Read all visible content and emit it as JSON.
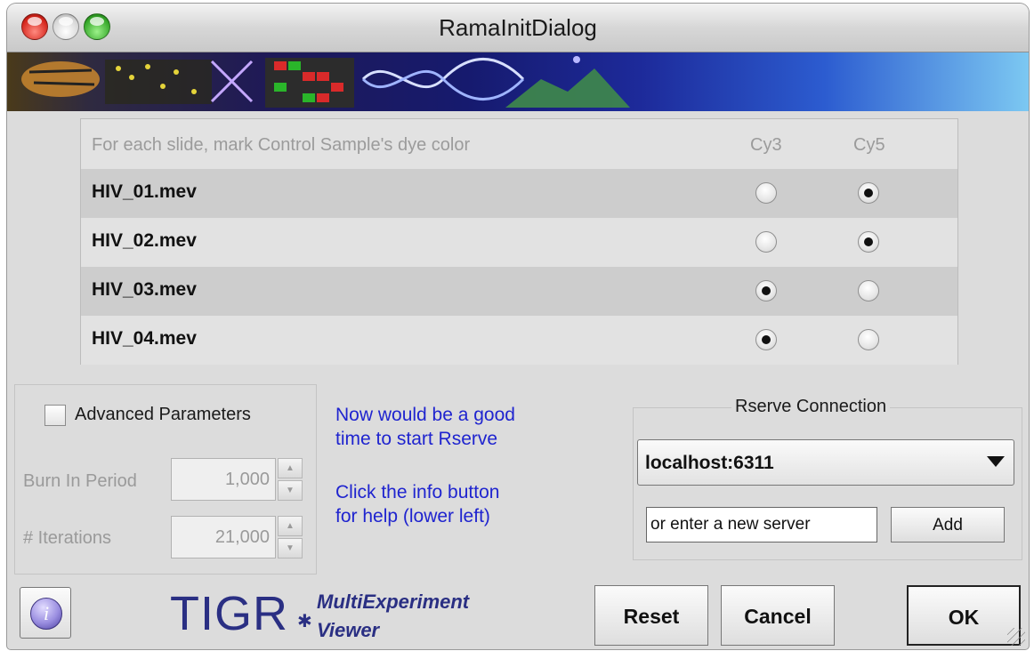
{
  "window": {
    "title": "RamaInitDialog"
  },
  "table": {
    "header": {
      "instruction": "For each slide, mark Control Sample's dye color",
      "col1": "Cy3",
      "col2": "Cy5"
    },
    "rows": [
      {
        "file": "HIV_01.mev",
        "selected": "Cy5"
      },
      {
        "file": "HIV_02.mev",
        "selected": "Cy5"
      },
      {
        "file": "HIV_03.mev",
        "selected": "Cy3"
      },
      {
        "file": "HIV_04.mev",
        "selected": "Cy3"
      }
    ]
  },
  "advanced": {
    "checkbox_label": "Advanced Parameters",
    "checked": false,
    "burn_in_label": "Burn In Period",
    "burn_in_value": "1,000",
    "iterations_label": "# Iterations",
    "iterations_value": "21,000"
  },
  "hint": {
    "line1": "Now would be a good",
    "line2": "time to start Rserve",
    "line3": "Click the info button",
    "line4": "for help (lower left)"
  },
  "rserve": {
    "title": "Rserve Connection",
    "selected_server": "localhost:6311",
    "new_server_value": "or enter a new server",
    "add_label": "Add"
  },
  "footer": {
    "logo_tigr": "TIGR",
    "logo_mev_line1": "MultiExperiment",
    "logo_mev_line2": "Viewer",
    "reset_label": "Reset",
    "cancel_label": "Cancel",
    "ok_label": "OK"
  },
  "icons": {
    "info": "info-icon",
    "dropdown": "chevron-down-icon",
    "resize": "resize-grip-icon"
  }
}
